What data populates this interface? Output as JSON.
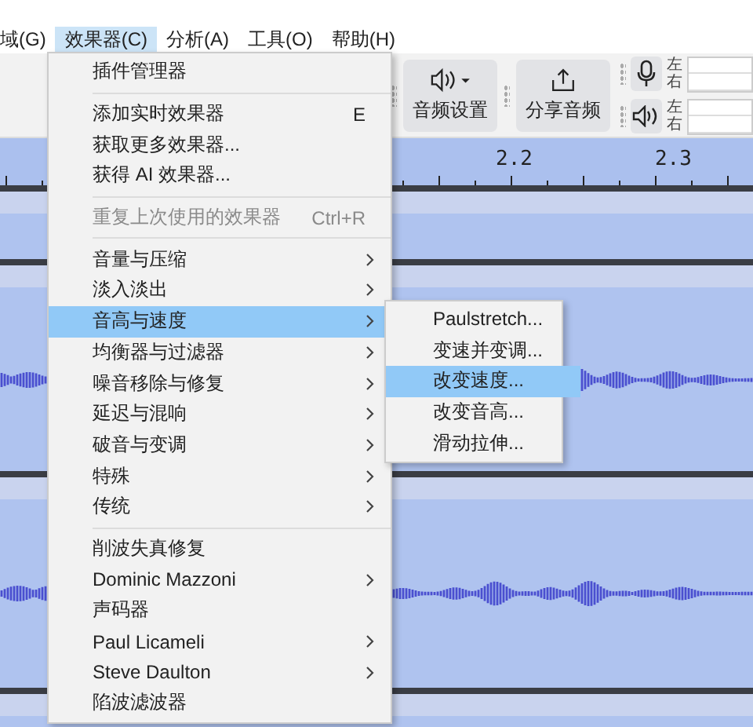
{
  "menubar": [
    {
      "label": "域(G)",
      "selected": false
    },
    {
      "label": "效果器(C)",
      "selected": true
    },
    {
      "label": "分析(A)",
      "selected": false
    },
    {
      "label": "工具(O)",
      "selected": false
    },
    {
      "label": "帮助(H)",
      "selected": false
    }
  ],
  "toolbar": {
    "buttons": [
      {
        "kind": "audio-setup",
        "label": "音频设置"
      },
      {
        "kind": "share",
        "label": "分享音频"
      }
    ],
    "meters": [
      {
        "kind": "record",
        "left": "左",
        "right": "右"
      },
      {
        "kind": "playback",
        "left": "左",
        "right": "右"
      }
    ]
  },
  "ruler": {
    "labels": [
      "2.2",
      "2.3"
    ]
  },
  "menu": {
    "items": [
      {
        "kind": "item",
        "label": "插件管理器",
        "disabled": false,
        "selected": false,
        "submenu": false
      },
      {
        "kind": "separator"
      },
      {
        "kind": "item",
        "label": "添加实时效果器",
        "shortcut": "E",
        "disabled": false,
        "selected": false,
        "submenu": false
      },
      {
        "kind": "item",
        "label": "获取更多效果器...",
        "disabled": false,
        "selected": false,
        "submenu": false
      },
      {
        "kind": "item",
        "label": "获得 AI 效果器...",
        "disabled": false,
        "selected": false,
        "submenu": false
      },
      {
        "kind": "separator"
      },
      {
        "kind": "item",
        "label": "重复上次使用的效果器",
        "shortcut": "Ctrl+R",
        "disabled": true,
        "selected": false,
        "submenu": false
      },
      {
        "kind": "separator"
      },
      {
        "kind": "item",
        "label": "音量与压缩",
        "disabled": false,
        "selected": false,
        "submenu": true
      },
      {
        "kind": "item",
        "label": "淡入淡出",
        "disabled": false,
        "selected": false,
        "submenu": true
      },
      {
        "kind": "item",
        "label": "音高与速度",
        "disabled": false,
        "selected": true,
        "submenu": true
      },
      {
        "kind": "item",
        "label": "均衡器与过滤器",
        "disabled": false,
        "selected": false,
        "submenu": true
      },
      {
        "kind": "item",
        "label": "噪音移除与修复",
        "disabled": false,
        "selected": false,
        "submenu": true
      },
      {
        "kind": "item",
        "label": "延迟与混响",
        "disabled": false,
        "selected": false,
        "submenu": true
      },
      {
        "kind": "item",
        "label": "破音与变调",
        "disabled": false,
        "selected": false,
        "submenu": true
      },
      {
        "kind": "item",
        "label": "特殊",
        "disabled": false,
        "selected": false,
        "submenu": true
      },
      {
        "kind": "item",
        "label": "传统",
        "disabled": false,
        "selected": false,
        "submenu": true
      },
      {
        "kind": "separator"
      },
      {
        "kind": "item",
        "label": "削波失真修复",
        "disabled": false,
        "selected": false,
        "submenu": false
      },
      {
        "kind": "item",
        "label": "Dominic Mazzoni",
        "disabled": false,
        "selected": false,
        "submenu": true
      },
      {
        "kind": "item",
        "label": "声码器",
        "disabled": false,
        "selected": false,
        "submenu": false
      },
      {
        "kind": "item",
        "label": "Paul Licameli",
        "disabled": false,
        "selected": false,
        "submenu": true
      },
      {
        "kind": "item",
        "label": "Steve Daulton",
        "disabled": false,
        "selected": false,
        "submenu": true
      },
      {
        "kind": "item",
        "label": "陷波滤波器",
        "disabled": false,
        "selected": false,
        "submenu": false
      }
    ]
  },
  "submenu": {
    "items": [
      {
        "label": "Paulstretch...",
        "selected": false
      },
      {
        "label": "变速并变调...",
        "selected": false
      },
      {
        "label": "改变速度...",
        "selected": true
      },
      {
        "label": "改变音高...",
        "selected": false
      },
      {
        "label": "滑动拉伸...",
        "selected": false
      }
    ]
  }
}
